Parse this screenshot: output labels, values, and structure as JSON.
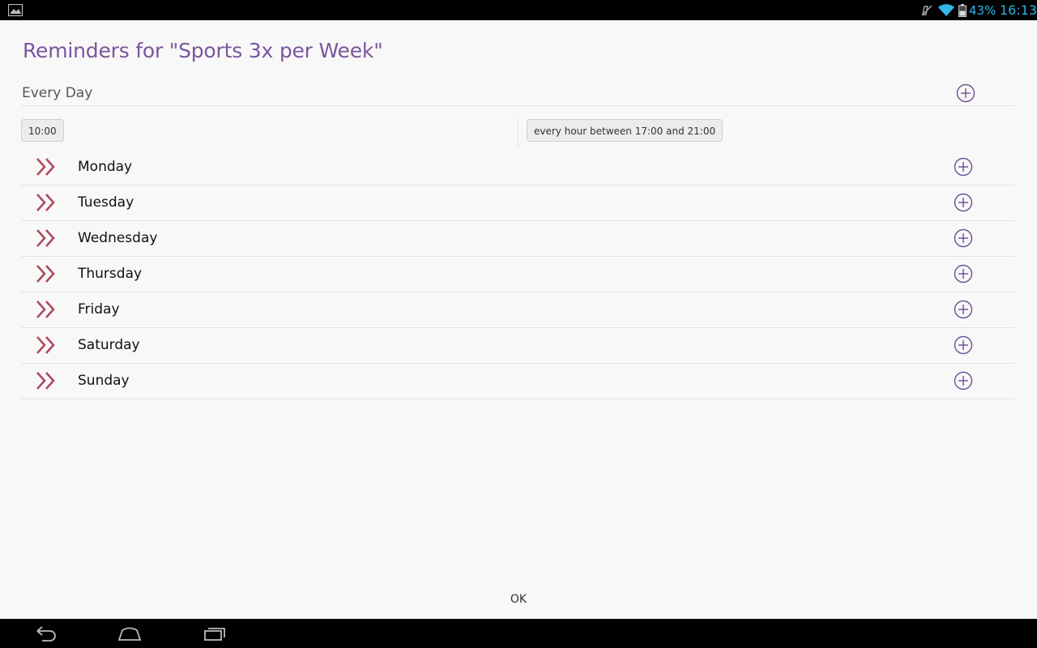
{
  "status_bar": {
    "battery_percent": "43%",
    "time": "16:13",
    "accent_color": "#33b5e5"
  },
  "dialog": {
    "title": "Reminders for \"Sports 3x per Week\"",
    "every_day": {
      "label": "Every Day",
      "reminders": [
        "10:00",
        "every hour between 17:00 and 21:00"
      ]
    },
    "days": [
      {
        "label": "Monday"
      },
      {
        "label": "Tuesday"
      },
      {
        "label": "Wednesday"
      },
      {
        "label": "Thursday"
      },
      {
        "label": "Friday"
      },
      {
        "label": "Saturday"
      },
      {
        "label": "Sunday"
      }
    ],
    "ok_label": "OK"
  },
  "colors": {
    "title": "#7b559e",
    "add_icon": "#6a4f93",
    "chevron": "#b04a5e"
  },
  "icons": {
    "add": "plus-circle-icon",
    "expand": "double-chevron-right-icon",
    "nav_back": "back-icon",
    "nav_home": "home-icon",
    "nav_recents": "recents-icon"
  }
}
